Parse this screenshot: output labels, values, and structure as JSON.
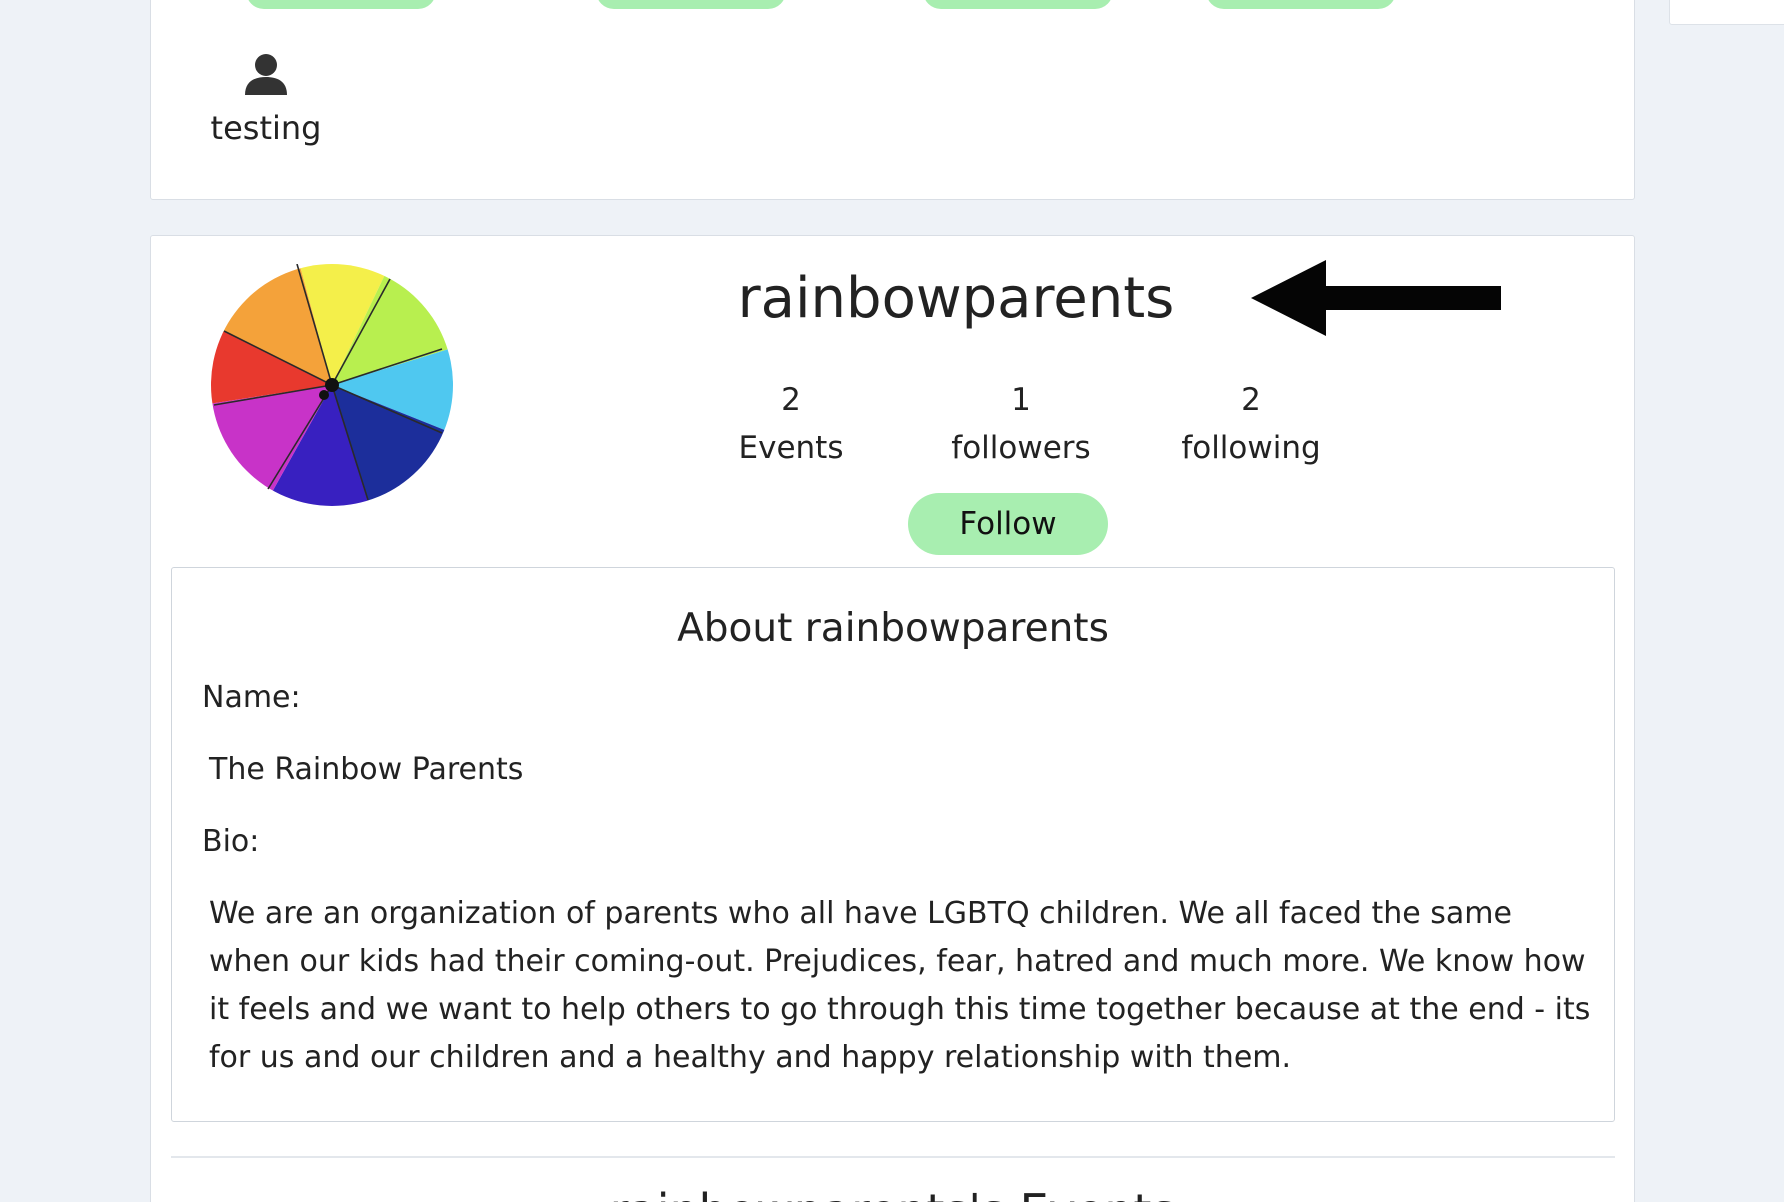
{
  "member": {
    "name": "testing",
    "icon": "person-icon"
  },
  "profile": {
    "username": "rainbowparents",
    "avatar_icon": "rainbow-umbrella-avatar",
    "stats": [
      {
        "value": "2",
        "label": "Events"
      },
      {
        "value": "1",
        "label": "followers"
      },
      {
        "value": "2",
        "label": "following"
      }
    ],
    "follow_label": "Follow",
    "follow_color": "#a8eeb0"
  },
  "about": {
    "title": "About rainbowparents",
    "name_label": "Name:",
    "name_value": "The Rainbow Parents",
    "bio_label": "Bio:",
    "bio_value": "We are an organization of parents who all have LGBTQ children. We all faced the same when our kids had their coming-out. Prejudices, fear, hatred and much more. We know how it feels and we want to help others to go through this time together because at the end - its for us and our children and a healthy and happy relationship with them."
  },
  "events_section": {
    "heading": "rainbowparents's Events"
  }
}
